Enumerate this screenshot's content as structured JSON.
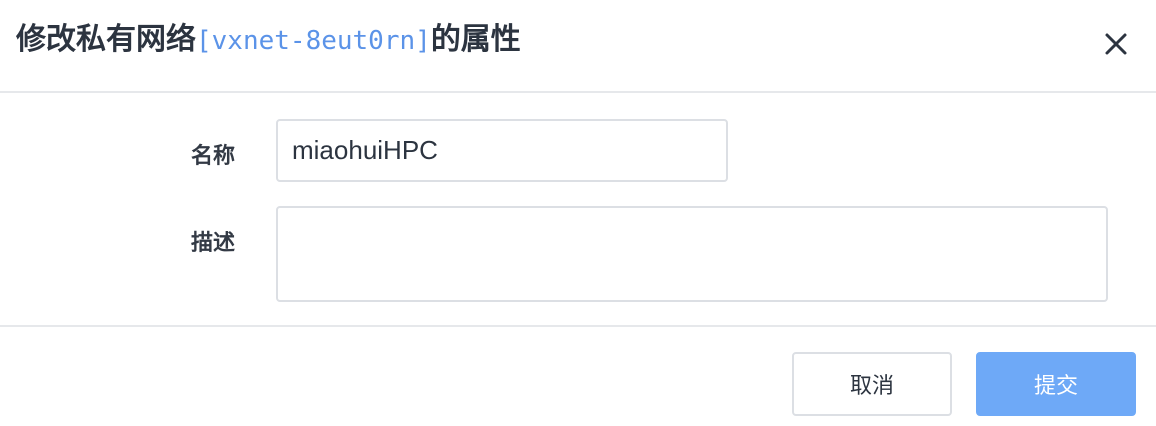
{
  "dialog": {
    "title_prefix": "修改私有网络",
    "resource_id": "[vxnet-8eut0rn]",
    "title_suffix": "的属性",
    "close_icon": "close-icon"
  },
  "form": {
    "name_label": "名称",
    "name_value": "miaohuiHPC",
    "description_label": "描述",
    "description_value": ""
  },
  "actions": {
    "cancel_label": "取消",
    "submit_label": "提交",
    "submit_color": "#6ea9f7"
  },
  "colors": {
    "resource_id": "#5b93e8",
    "border": "#dcdfe4",
    "divider": "#e6e8eb"
  }
}
